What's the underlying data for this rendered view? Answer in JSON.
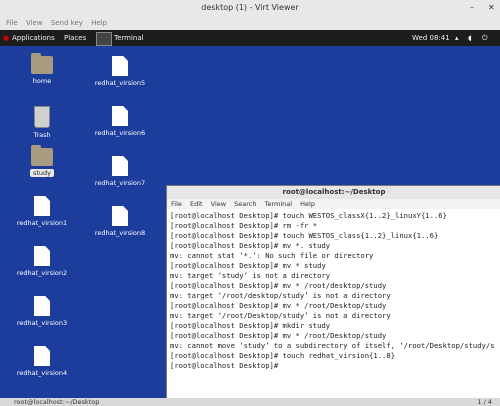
{
  "viewer": {
    "title": "desktop (1) - Virt Viewer",
    "menu": [
      "File",
      "View",
      "Send key",
      "Help"
    ]
  },
  "topbar": {
    "applications": "Applications",
    "places": "Places",
    "terminal": "Terminal",
    "clock": "Wed 08:41"
  },
  "desktop": {
    "icons": [
      "home",
      "Trash",
      "study",
      "redhat_virsion1",
      "redhat_virsion2",
      "redhat_virsion3",
      "redhat_virsion4",
      "redhat_virsion5",
      "redhat_virsion6",
      "redhat_virsion7",
      "redhat_virsion8"
    ]
  },
  "terminal": {
    "title": "root@localhost:~/Desktop",
    "menu": [
      "File",
      "Edit",
      "View",
      "Search",
      "Terminal",
      "Help"
    ],
    "lines": [
      "[root@localhost Desktop]# touch WESTOS_classX{1..2}_linuxY{1..6}",
      "[root@localhost Desktop]# rm -fr *",
      "[root@localhost Desktop]# touch WESTOS_class{1..2}_linux{1..6}",
      "[root@localhost Desktop]# mv *. study",
      "mv: cannot stat ‘*.’: No such file or directory",
      "[root@localhost Desktop]# mv * study",
      "mv: target ‘study’ is not a directory",
      "[root@localhost Desktop]# mv * /root/desktop/study",
      "mv: target ‘/root/desktop/study’ is not a directory",
      "[root@localhost Desktop]# mv * /root/Desktop/study",
      "mv: target ‘/root/Desktop/study’ is not a directory",
      "[root@localhost Desktop]# mkdir study",
      "[root@localhost Desktop]# mv * /root/Desktop/study",
      "mv: cannot move ‘study’ to a subdirectory of itself, ‘/root/Desktop/study/s",
      "[root@localhost Desktop]# touch redhat_virsion{1..8}",
      "[root@localhost Desktop]# "
    ]
  },
  "taskbar": {
    "task": "root@localhost:~/Desktop",
    "page": "1 / 4"
  }
}
